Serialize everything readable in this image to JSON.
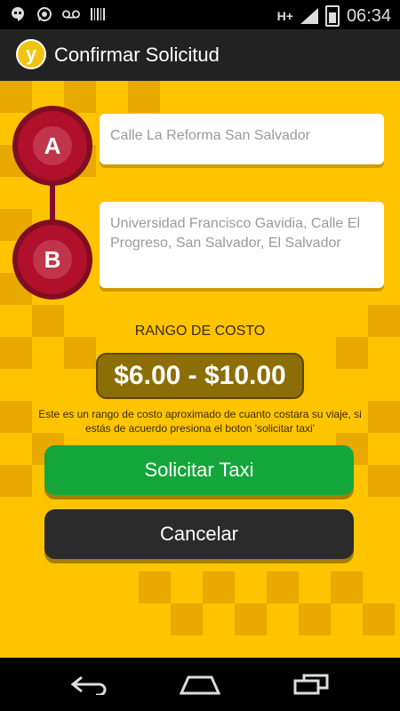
{
  "status_bar": {
    "icons_left": [
      "hangouts-icon",
      "whatsapp-icon",
      "voicemail-icon",
      "barcode-icon"
    ],
    "network": "H+",
    "time": "06:34"
  },
  "action_bar": {
    "logo_letter": "y",
    "title": "Confirmar Solicitud"
  },
  "route": {
    "point_a_label": "A",
    "point_b_label": "B",
    "origin": "Calle La Reforma San Salvador",
    "destination": "Universidad Francisco Gavidia, Calle El Progreso, San Salvador, El Salvador"
  },
  "cost": {
    "title": "RANGO DE COSTO",
    "range": "$6.00 - $10.00",
    "note": "Este es un rango de costo aproximado de cuanto costara su viaje, si estás de acuerdo presiona el boton 'solicitar taxi'"
  },
  "buttons": {
    "request": "Solicitar Taxi",
    "cancel": "Cancelar"
  },
  "colors": {
    "background": "#ffc400",
    "accent_red": "#b0102a",
    "price_bg": "#8b6e06",
    "request_btn": "#14a63b",
    "cancel_btn": "#2b2b2b"
  },
  "nav_bar": {
    "icons": [
      "back-icon",
      "home-icon",
      "recent-apps-icon"
    ]
  }
}
